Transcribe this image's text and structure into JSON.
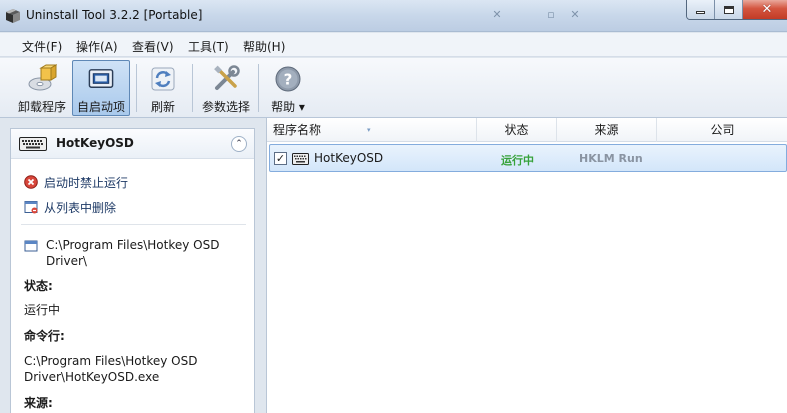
{
  "window": {
    "title": "Uninstall Tool 3.2.2 [Portable]",
    "controls": {
      "minimize": "minimize",
      "maximize": "maximize",
      "close": "✕"
    }
  },
  "menu": [
    "文件(F)",
    "操作(A)",
    "查看(V)",
    "工具(T)",
    "帮助(H)"
  ],
  "toolbar": {
    "uninstall_label": "卸载程序",
    "startup_label": "自启动项",
    "refresh_label": "刷新",
    "options_label": "参数选择",
    "help_label": "帮助 ▾"
  },
  "left_panel": {
    "title": "HotKeyOSD",
    "actions": {
      "disable_startup": "启动时禁止运行",
      "remove_from_list": "从列表中删除"
    },
    "path_line1": "C:\\Program Files\\Hotkey OSD",
    "path_line2": "Driver\\",
    "status_label": "状态:",
    "status_value": "运行中",
    "command_label": "命令行:",
    "command_line1": "C:\\Program Files\\Hotkey OSD",
    "command_line2": "Driver\\HotKeyOSD.exe",
    "source_label": "来源:"
  },
  "list": {
    "columns": [
      "程序名称",
      "状态",
      "来源",
      "公司"
    ],
    "rows": [
      {
        "checked": "✓",
        "name": "HotKeyOSD",
        "status": "运行中",
        "source": "HKLM Run",
        "company": ""
      }
    ]
  },
  "colors": {
    "running_status": "#36a23a",
    "source_text": "#8a94a2",
    "selection_border": "#84acdd",
    "close_button": "#c23b26"
  }
}
